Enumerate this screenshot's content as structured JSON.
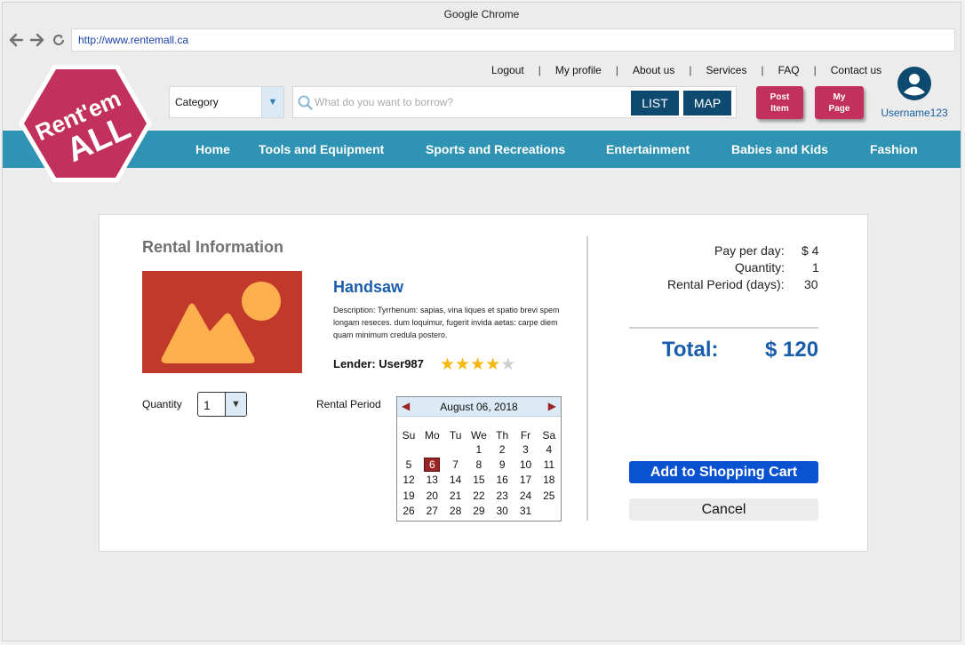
{
  "browser": {
    "title": "Google Chrome",
    "url": "http://www.rentemall.ca"
  },
  "logo": {
    "line1": "Rent'em",
    "line2": "ALL"
  },
  "top_links": [
    "Logout",
    "My profile",
    "About us",
    "Services",
    "FAQ",
    "Contact us"
  ],
  "search": {
    "category_label": "Category",
    "placeholder": "What do you want to borrow?",
    "list_label": "LIST",
    "map_label": "MAP"
  },
  "actions": {
    "post_item": "Post\nItem",
    "my_page": "My\nPage"
  },
  "user": {
    "name": "Username123"
  },
  "main_nav": [
    "Home",
    "Tools and Equipment",
    "Sports and Recreations",
    "Entertainment",
    "Babies and Kids",
    "Fashion"
  ],
  "rental": {
    "heading": "Rental Information",
    "product_name": "Handsaw",
    "description": "Description: Tyrrhenum: sapias, vina liques et spatio brevi spem longam reseces. dum loquimur, fugerit invida aetas: carpe diem quam minimum credula postero.",
    "lender": "Lender: User987",
    "rating": 4,
    "rating_max": 5,
    "quantity_label": "Quantity",
    "quantity_value": "1",
    "period_label": "Rental Period"
  },
  "calendar": {
    "month_label": "August 06, 2018",
    "weekdays": [
      "Su",
      "Mo",
      "Tu",
      "We",
      "Th",
      "Fr",
      "Sa"
    ],
    "first_weekday": 3,
    "days_in_month": 31,
    "selected_day": 6
  },
  "summary": {
    "pay_per_day_label": "Pay per day:",
    "pay_per_day_value": "$ 4",
    "quantity_label": "Quantity:",
    "quantity_value": "1",
    "period_label": "Rental Period (days):",
    "period_value": "30",
    "total_label": "Total:",
    "total_value": "$ 120"
  },
  "buttons": {
    "add_to_cart": "Add to Shopping Cart",
    "cancel": "Cancel"
  },
  "colors": {
    "nav_bg": "#2f93b3",
    "brand_pink": "#c2305d",
    "dark_btn": "#0e4a70",
    "primary_blue": "#0a52d0",
    "title_blue": "#1a5dab",
    "selected_day": "#9b2525"
  },
  "icons": {
    "back": "arrow-left-icon",
    "forward": "arrow-right-icon",
    "reload": "reload-icon",
    "search": "search-icon",
    "user": "user-avatar-icon",
    "image_placeholder": "image-placeholder-icon"
  }
}
